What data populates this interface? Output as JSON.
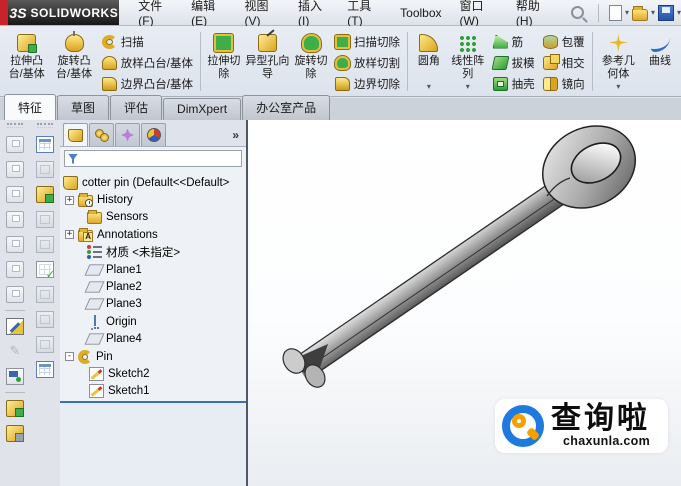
{
  "glyphs": {
    "caret": "▾",
    "overflow": "»"
  },
  "titlebar": {
    "logo_prefix": "3S",
    "brand": "SOLIDWORKS",
    "menus": [
      "文件(F)",
      "编辑(E)",
      "视图(V)",
      "插入(I)",
      "工具(T)",
      "Toolbox",
      "窗口(W)",
      "帮助(H)"
    ]
  },
  "ribbon": {
    "large": [
      {
        "label": "拉伸凸台/基体"
      },
      {
        "label": "旋转凸台/基体"
      },
      {
        "label": "拉伸切除"
      },
      {
        "label": "异型孔向导"
      },
      {
        "label": "旋转切除"
      },
      {
        "label": "圆角"
      },
      {
        "label": "线性阵列"
      },
      {
        "label": "参考几何体"
      },
      {
        "label": "曲线"
      }
    ],
    "stacks": [
      [
        "扫描",
        "放样凸台/基体",
        "边界凸台/基体"
      ],
      [
        "扫描切除",
        "放样切割",
        "边界切除"
      ],
      [
        "筋",
        "拔模",
        "抽壳"
      ],
      [
        "包覆",
        "相交",
        "镜向"
      ]
    ]
  },
  "command_tabs": {
    "active": "特征",
    "items": [
      "特征",
      "草图",
      "评估",
      "DimXpert",
      "办公室产品"
    ]
  },
  "feature_manager": {
    "filter_value": "",
    "tree": {
      "root": {
        "label": "cotter pin  (Default<<Default>"
      },
      "items": [
        {
          "label": "History",
          "expand": "+"
        },
        {
          "label": "Sensors",
          "expand": ""
        },
        {
          "label": "Annotations",
          "expand": "+"
        },
        {
          "label": "材质 <未指定>",
          "expand": ""
        },
        {
          "label": "Plane1",
          "expand": ""
        },
        {
          "label": "Plane2",
          "expand": ""
        },
        {
          "label": "Plane3",
          "expand": ""
        },
        {
          "label": "Origin",
          "expand": ""
        },
        {
          "label": "Plane4",
          "expand": ""
        },
        {
          "label": "Pin",
          "expand": "-"
        },
        {
          "label": "Sketch2",
          "expand": ""
        },
        {
          "label": "Sketch1",
          "expand": ""
        }
      ]
    }
  },
  "watermark": {
    "title": "查询啦",
    "domain": "chaxunla.com"
  },
  "colors": {
    "logo_red": "#c8232c",
    "rollback_blue": "#3b6fb5",
    "watermark_blue": "#1f7ae0",
    "watermark_orange": "#f5a100",
    "feature_yellow": "#d9a41e",
    "cut_green": "#3fae49"
  }
}
